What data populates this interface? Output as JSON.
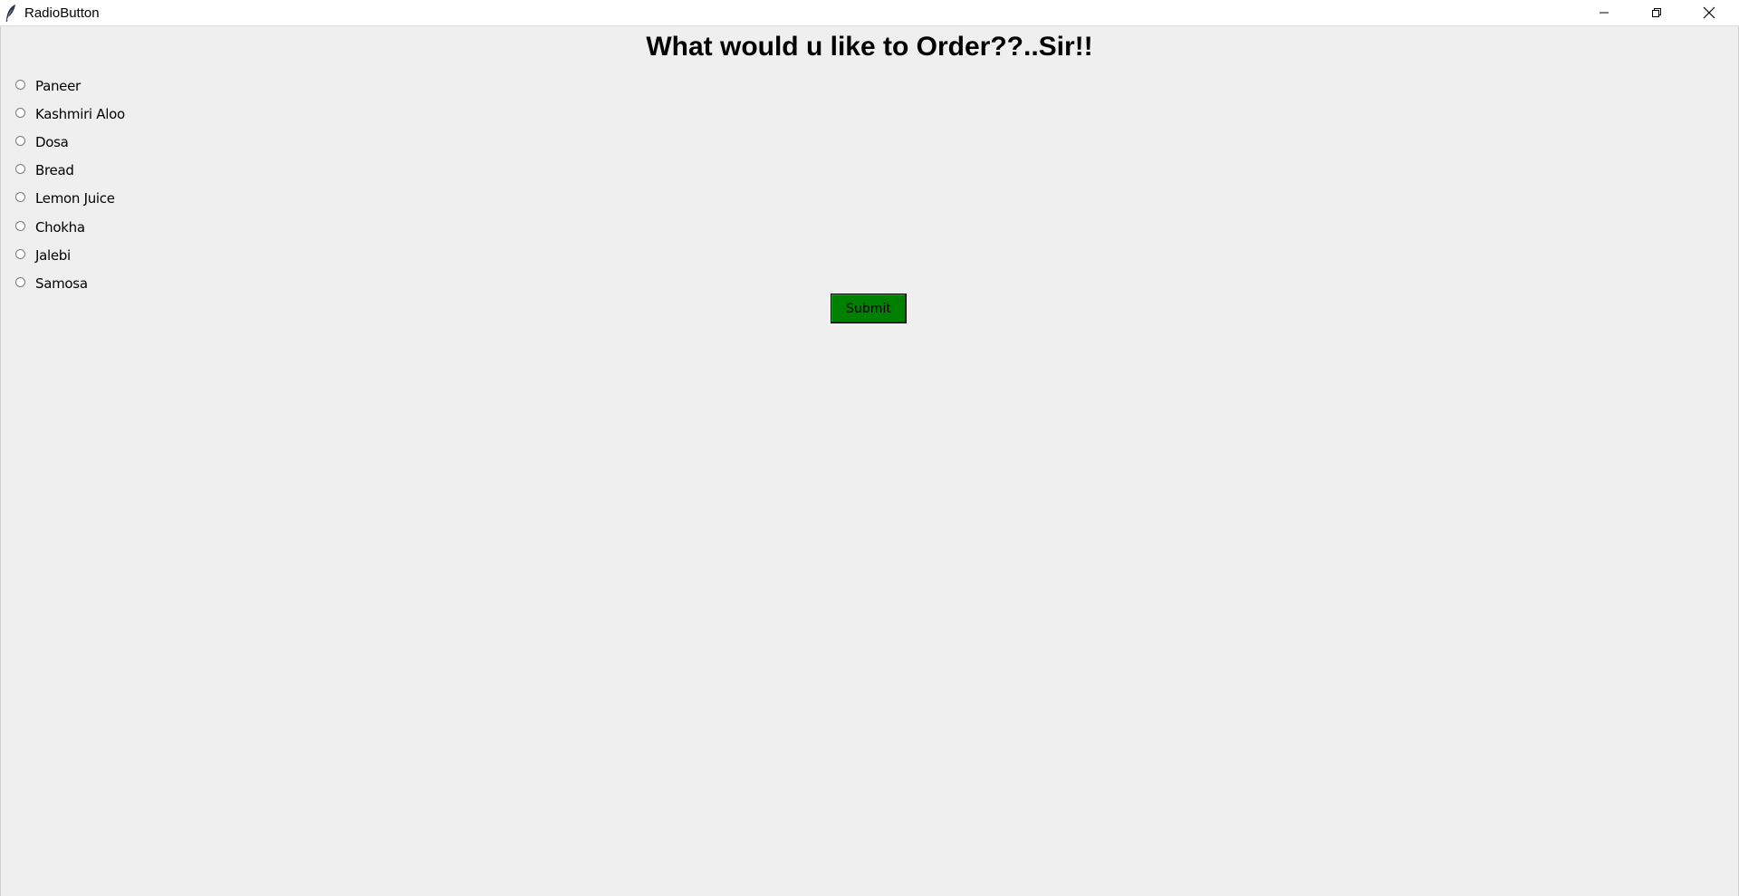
{
  "window": {
    "title": "RadioButton",
    "app_icon": "feather-icon",
    "controls": {
      "minimize": "minimize-icon",
      "restore": "restore-icon",
      "close": "close-icon"
    }
  },
  "main": {
    "heading": "What would u like to Order??..Sir!!",
    "options": [
      {
        "label": "Paneer",
        "selected": false
      },
      {
        "label": "Kashmiri Aloo",
        "selected": false
      },
      {
        "label": "Dosa",
        "selected": false
      },
      {
        "label": "Bread",
        "selected": false
      },
      {
        "label": "Lemon Juice",
        "selected": false
      },
      {
        "label": "Chokha",
        "selected": false
      },
      {
        "label": "Jalebi",
        "selected": false
      },
      {
        "label": "Samosa",
        "selected": false
      }
    ],
    "submit_label": "Submit"
  },
  "colors": {
    "background": "#efefef",
    "submit_button": "#008000"
  }
}
